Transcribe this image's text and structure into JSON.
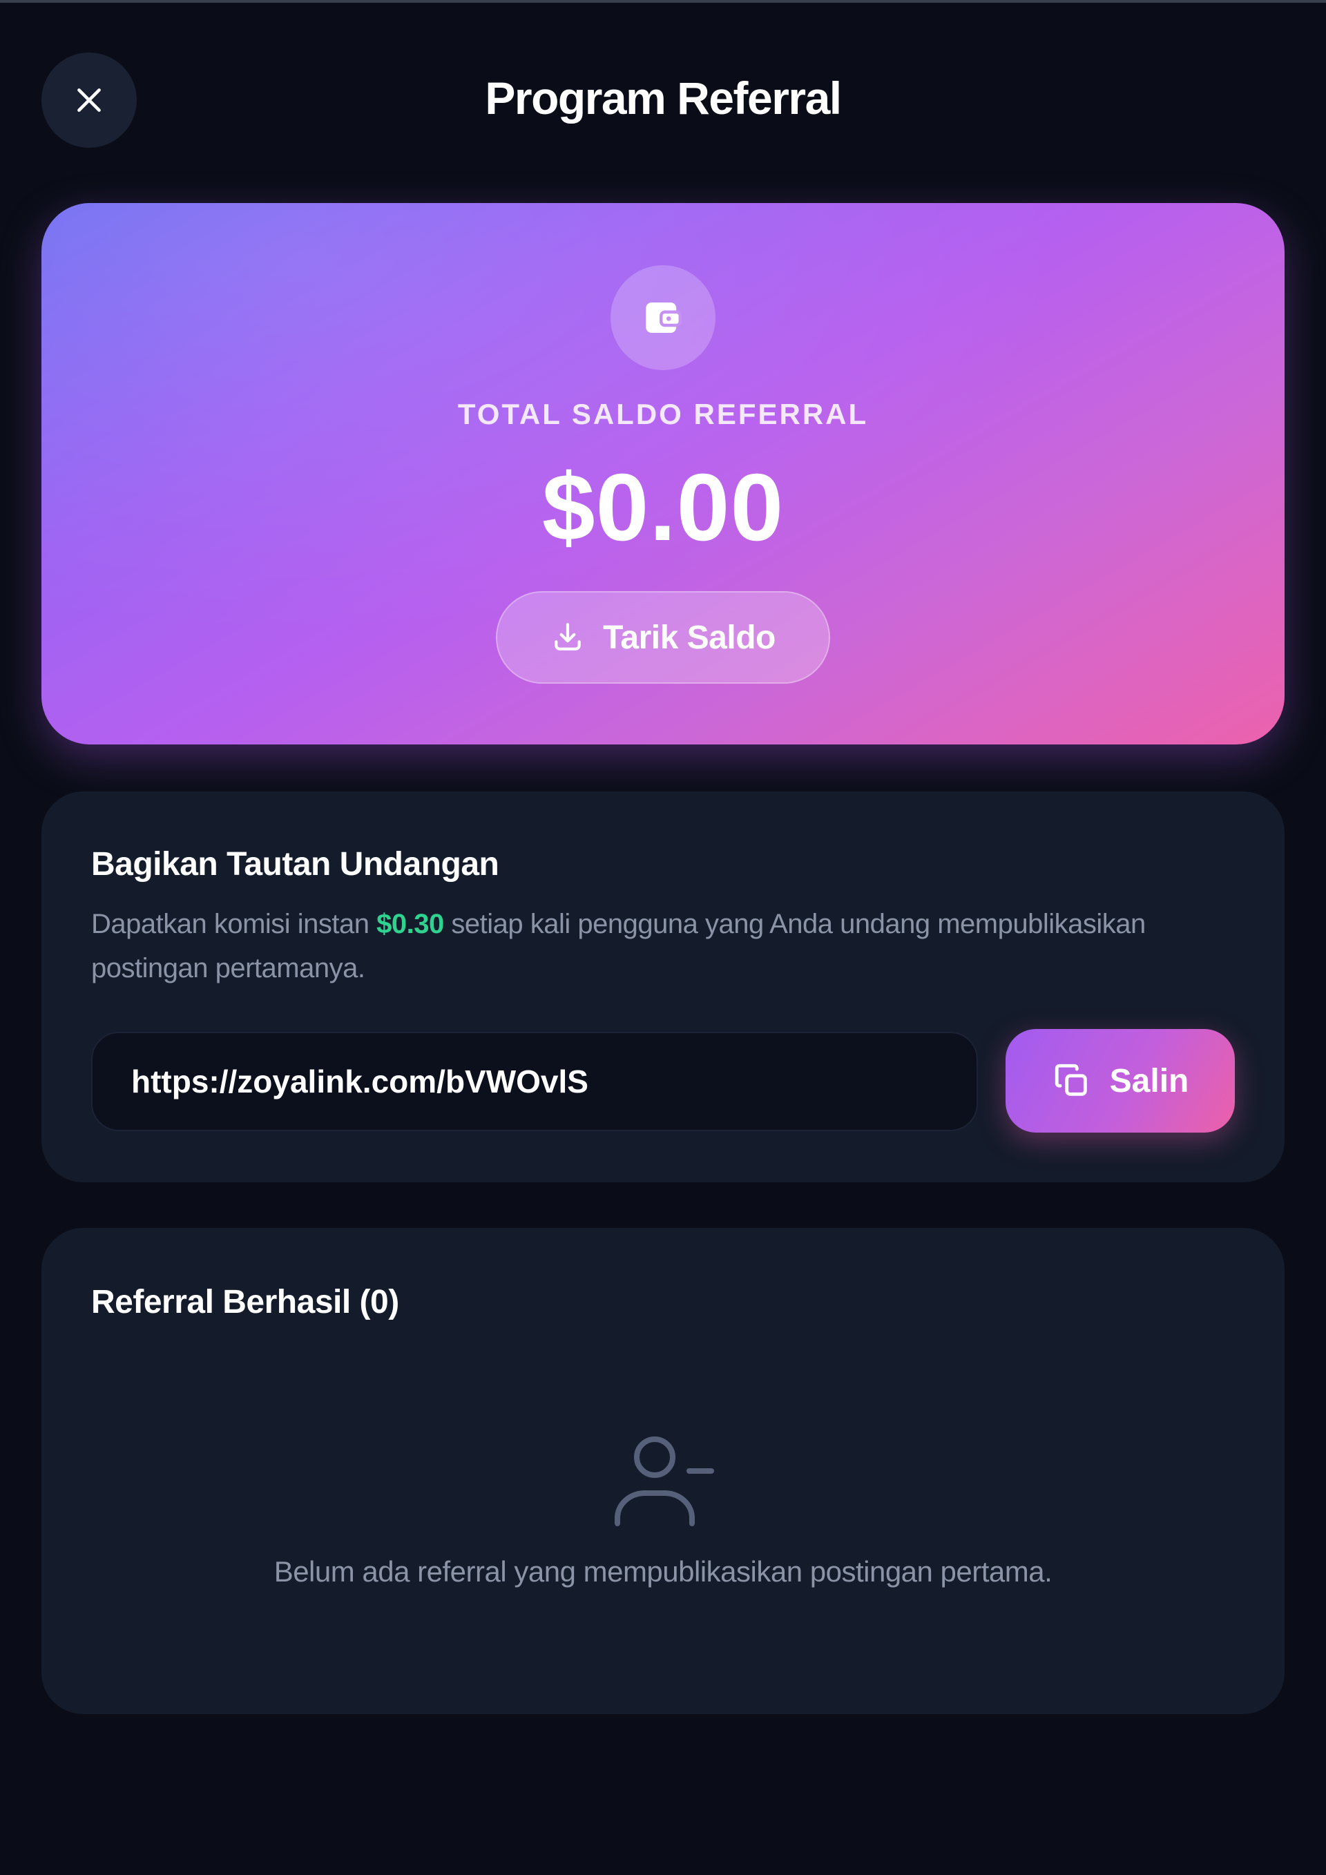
{
  "header": {
    "title": "Program Referral",
    "close_icon": "close-icon"
  },
  "balance": {
    "icon": "wallet-icon",
    "label": "TOTAL SALDO REFERRAL",
    "amount": "$0.00",
    "withdraw_label": "Tarik Saldo",
    "withdraw_icon": "download-icon"
  },
  "share": {
    "title": "Bagikan Tautan Undangan",
    "desc_before": "Dapatkan komisi instan ",
    "desc_amount": "$0.30",
    "desc_after": " setiap kali pengguna yang Anda undang mempublikasikan postingan pertamanya.",
    "link": "https://zoyalink.com/bVWOvlS",
    "copy_label": "Salin",
    "copy_icon": "copy-icon"
  },
  "referrals": {
    "title": "Referral Berhasil (0)",
    "empty_icon": "user-minus-icon",
    "empty_text": "Belum ada referral yang mempublikasikan postingan pertama."
  },
  "colors": {
    "background": "#0a0d17",
    "card": "#141b2b",
    "accent_green": "#2fd28f",
    "gradient_start": "#6f6cf2",
    "gradient_end": "#ec62ad"
  }
}
